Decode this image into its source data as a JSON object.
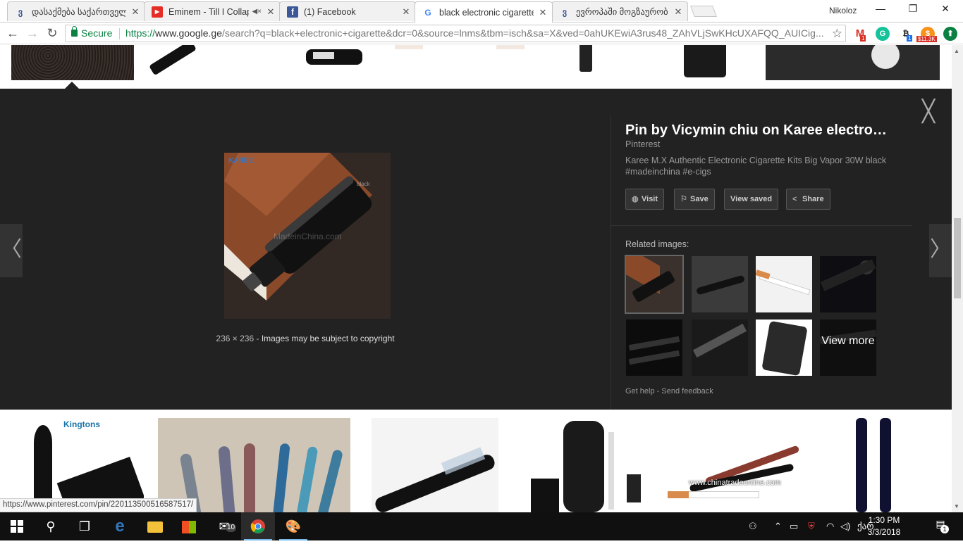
{
  "browser": {
    "tabs": [
      {
        "title": "დასაქმება საქართველ",
        "favicon": "georgian-letter-favicon",
        "glyph": "ვ",
        "color": "#3b5998"
      },
      {
        "title": "Eminem - Till I Collaps",
        "favicon": "youtube-favicon",
        "glyph": "▶",
        "color": "#e52d27"
      },
      {
        "title": "(1) Facebook",
        "favicon": "facebook-favicon",
        "glyph": "f",
        "color": "#3b5998"
      },
      {
        "title": "black electronic cigarette",
        "favicon": "google-favicon",
        "glyph": "G",
        "color": "#4285f4"
      },
      {
        "title": "ევროპაში მოგზაურობ",
        "favicon": "georgian-letter-favicon",
        "glyph": "ვ",
        "color": "#3b5998"
      }
    ],
    "close_glyph": "✕",
    "user_name": "Nikoloz",
    "window_controls": {
      "minimize": "—",
      "maximize": "❐",
      "close": "✕"
    },
    "nav": {
      "back": "←",
      "forward": "→",
      "reload": "↻"
    },
    "address": {
      "secure_label": "Secure",
      "url_scheme": "https://",
      "url_host": "www.google.ge",
      "url_rest": "/search?q=black+electronic+cigarette&dcr=0&source=lnms&tbm=isch&sa=X&ved=0ahUKEwiA3rus48_ZAhVLjSwKHcUXAFQQ_AUICig...",
      "star": "☆"
    },
    "extensions": [
      {
        "name": "gmail-extension",
        "glyph": "M",
        "badge": "1",
        "color": "#d93025"
      },
      {
        "name": "grammarly-extension",
        "glyph": "G",
        "badge": "",
        "color": "#15c39a"
      },
      {
        "name": "crypto-extension",
        "glyph": "₿",
        "badge": "1",
        "color": "#222222"
      },
      {
        "name": "price-extension",
        "glyph": "$",
        "badge": "$11.3K",
        "color": "#f7931a"
      },
      {
        "name": "download-extension",
        "glyph": "⬆",
        "badge": "",
        "color": "#0b8043"
      }
    ]
  },
  "viewer": {
    "title": "Pin by Vicymin chiu on Karee electro…",
    "source": "Pinterest",
    "description": "Karee M.X Authentic Electronic Cigarette Kits Big Vapor 30W black #madeinchina #e-cigs",
    "image_brand": "KAREE",
    "image_watermark_1": "black",
    "image_watermark_2": "MadeinChina.com",
    "dimensions": "236 × 236",
    "dim_sep": "-",
    "copyright": "Images may be subject to copyright",
    "actions": [
      {
        "label": "Visit",
        "icon": "globe-icon",
        "glyph": "◍"
      },
      {
        "label": "Save",
        "icon": "bookmark-icon",
        "glyph": "⚐"
      },
      {
        "label": "View saved",
        "icon": "",
        "glyph": ""
      },
      {
        "label": "Share",
        "icon": "share-icon",
        "glyph": "<"
      }
    ],
    "related_label": "Related images:",
    "view_more": "View more",
    "help": "Get help",
    "help_sep": "-",
    "feedback": "Send feedback",
    "close_glyph": "╳",
    "prev_glyph": "〈",
    "next_glyph": "〉"
  },
  "results_preview": {
    "kingtons_text": "Kingtons",
    "chinatrade_text": "www.chinatradeonline.com"
  },
  "status_url": "https://www.pinterest.com/pin/220113500516587517/",
  "taskbar": {
    "mail_badge": "10",
    "language": "ქარ",
    "time": "1:30 PM",
    "date": "3/3/2018",
    "notification_count": "1"
  }
}
